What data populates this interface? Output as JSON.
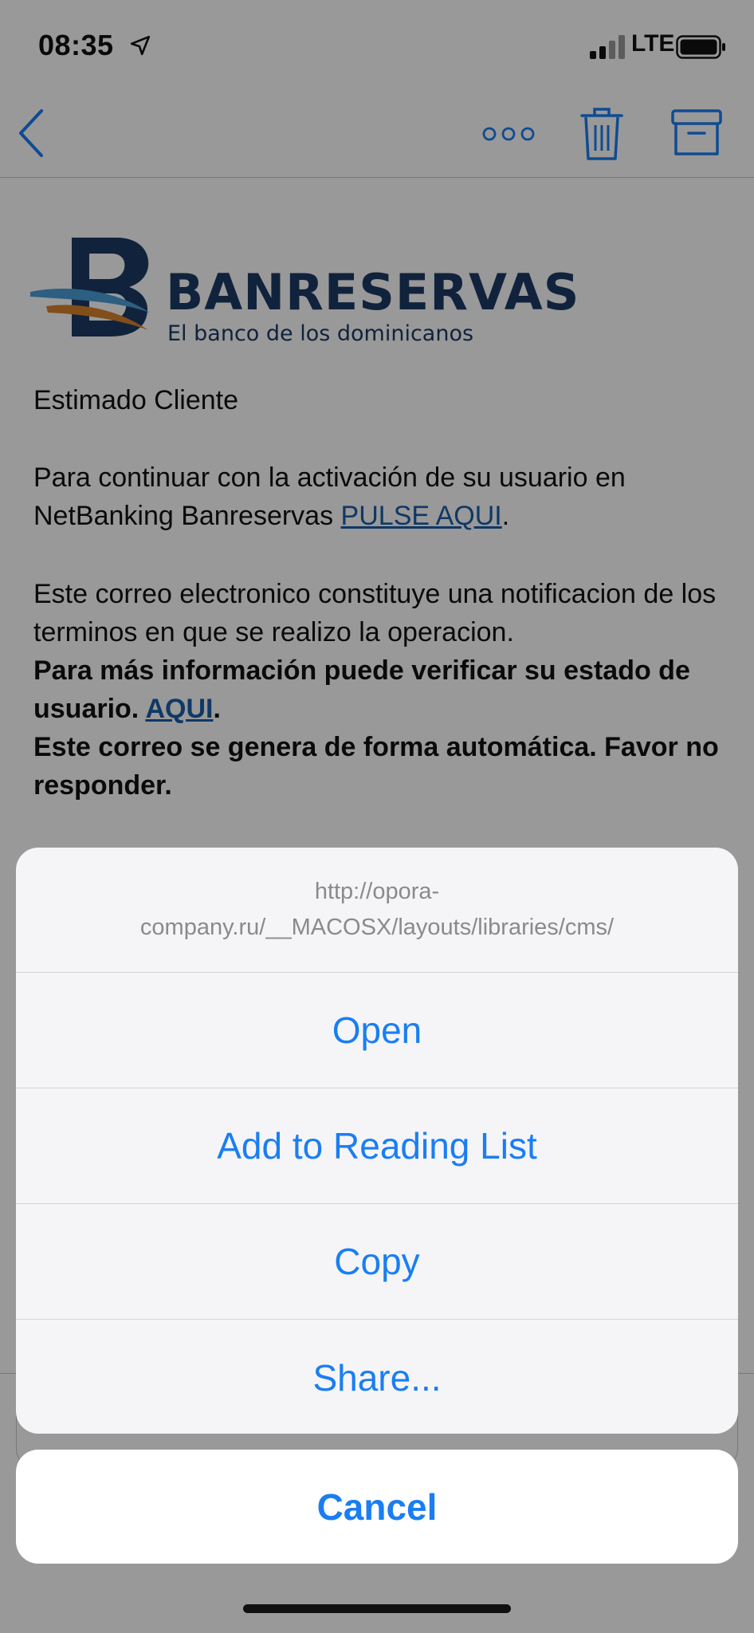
{
  "status": {
    "time": "08:35",
    "network": "LTE",
    "icons": [
      "location-arrow-icon",
      "signal-icon",
      "battery-icon"
    ]
  },
  "nav": {
    "icons": [
      "back-chevron-icon",
      "more-icon",
      "trash-icon",
      "archive-icon"
    ]
  },
  "email": {
    "logo": {
      "name": "BANRESERVAS",
      "tagline": "El banco de los dominicanos"
    },
    "greeting": "Estimado Cliente",
    "para1_text": "Para continuar con la activación de su usuario en NetBanking Banreservas ",
    "para1_link": "PULSE AQUI",
    "para1_end": ".",
    "para2_line1": "Este correo electronico constituye una notificacion de los terminos en que se realizo la operacion.",
    "para2_bold1": "Para más información puede verificar su estado de usuario. ",
    "para2_link": "AQUI",
    "para2_bold1_end": ".",
    "para2_bold2": "Este correo se genera de forma automática. Favor no responder."
  },
  "sheet": {
    "url": "http://opora-company.ru/__MACOSX/layouts/libraries/cms/",
    "items": [
      "Open",
      "Add to Reading List",
      "Copy",
      "Share..."
    ],
    "cancel": "Cancel"
  },
  "colors": {
    "accent": "#1a7ef2",
    "link": "#1a5ea8",
    "brand": "#1d3a64",
    "brand_orange": "#d9822b",
    "brand_blue": "#4a9fd8"
  }
}
